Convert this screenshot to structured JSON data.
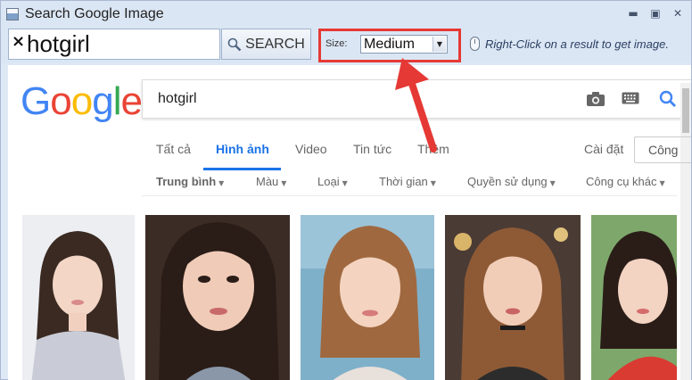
{
  "window": {
    "title": "Search Google Image"
  },
  "toolbar": {
    "clear_icon": "×",
    "search_value": "hotgirl",
    "search_button_label": "SEARCH",
    "size_label": "Size:",
    "size_selected": "Medium",
    "hint": "Right-Click on a result to get image."
  },
  "google": {
    "logo_letters": [
      "G",
      "o",
      "o",
      "g",
      "l",
      "e"
    ],
    "query": "hotgirl",
    "tabs": [
      {
        "label": "Tất cả",
        "active": false
      },
      {
        "label": "Hình ảnh",
        "active": true
      },
      {
        "label": "Video",
        "active": false
      },
      {
        "label": "Tin tức",
        "active": false
      },
      {
        "label": "Thêm",
        "active": false
      }
    ],
    "settings_label": "Cài đặt",
    "tools_label": "Công",
    "filters": [
      {
        "label": "Trung bình",
        "bold": true
      },
      {
        "label": "Màu",
        "bold": false
      },
      {
        "label": "Loại",
        "bold": false
      },
      {
        "label": "Thời gian",
        "bold": false
      },
      {
        "label": "Quyền sử dụng",
        "bold": false
      },
      {
        "label": "Công cụ khác",
        "bold": false
      }
    ]
  },
  "colors": {
    "highlight_border": "#e53935",
    "active_tab": "#1a73e8",
    "window_chrome": "#dbe6f4"
  }
}
